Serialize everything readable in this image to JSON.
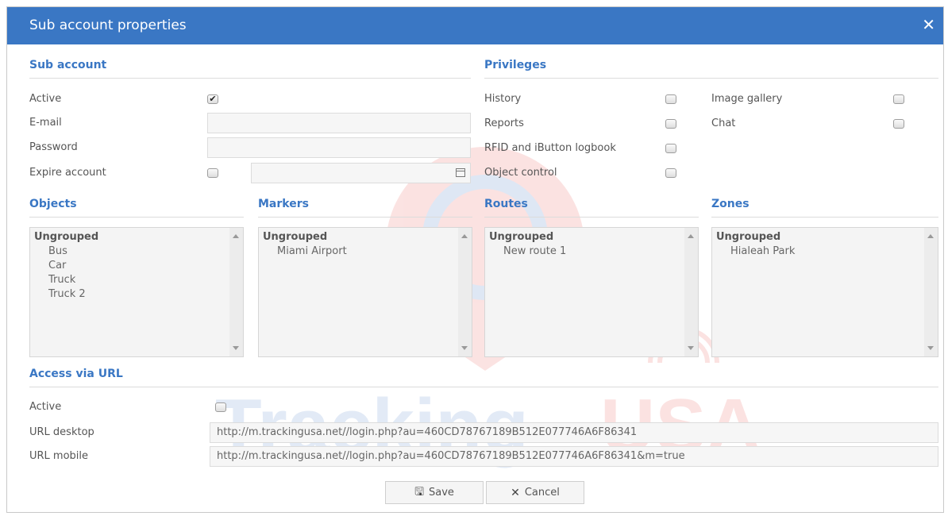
{
  "dialog": {
    "title": "Sub account properties",
    "close_icon": "close-icon"
  },
  "watermark": {
    "brand_left": "Tracking",
    "brand_right": "USA"
  },
  "sub_account": {
    "heading": "Sub account",
    "active_label": "Active",
    "active_checked": true,
    "email_label": "E-mail",
    "email_value": "",
    "password_label": "Password",
    "password_value": "",
    "expire_label": "Expire account",
    "expire_checked": false,
    "expire_date": ""
  },
  "privileges": {
    "heading": "Privileges",
    "items": [
      {
        "label": "History",
        "checked": false
      },
      {
        "label": "Reports",
        "checked": false
      },
      {
        "label": "RFID and iButton logbook",
        "checked": false
      },
      {
        "label": "Object control",
        "checked": false
      },
      {
        "label": "Image gallery",
        "checked": false
      },
      {
        "label": "Chat",
        "checked": false
      }
    ]
  },
  "objects": {
    "heading": "Objects",
    "group": "Ungrouped",
    "items": [
      "Bus",
      "Car",
      "Truck",
      "Truck 2"
    ]
  },
  "markers": {
    "heading": "Markers",
    "group": "Ungrouped",
    "items": [
      "Miami Airport"
    ]
  },
  "routes": {
    "heading": "Routes",
    "group": "Ungrouped",
    "items": [
      "New route 1"
    ]
  },
  "zones": {
    "heading": "Zones",
    "group": "Ungrouped",
    "items": [
      "Hialeah Park"
    ]
  },
  "access_url": {
    "heading": "Access via URL",
    "active_label": "Active",
    "active_checked": false,
    "desktop_label": "URL desktop",
    "desktop_value": "http://m.trackingusa.net//login.php?au=460CD78767189B512E077746A6F86341",
    "mobile_label": "URL mobile",
    "mobile_value": "http://m.trackingusa.net//login.php?au=460CD78767189B512E077746A6F86341&m=true"
  },
  "buttons": {
    "save_label": "Save",
    "cancel_label": "Cancel"
  },
  "colors": {
    "accent": "#3a77c4",
    "watermark_red": "#e53935",
    "watermark_blue": "#1e5bb8"
  }
}
